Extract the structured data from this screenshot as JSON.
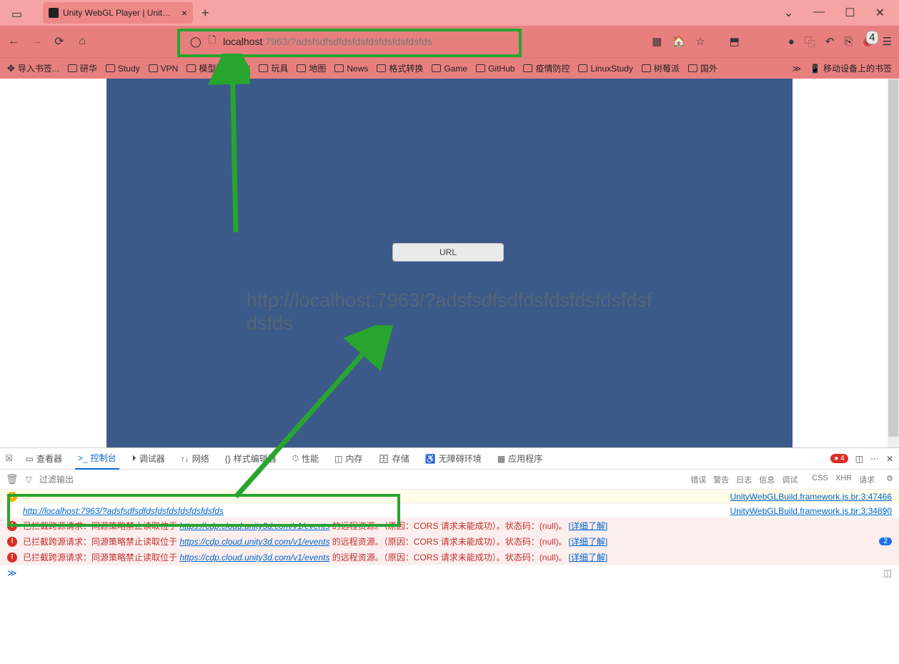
{
  "tab": {
    "title": "Unity WebGL Player | UnityW"
  },
  "url": {
    "host": "localhost",
    "port": ":7963",
    "path": "/?adsfsdfsdfdsfdsfdsfdsfdsfdsfds"
  },
  "bookmarks": {
    "import": "导入书签...",
    "items": [
      "研华",
      "Study",
      "VPN",
      "模型下载网站",
      "玩具",
      "地图",
      "News",
      "格式转换",
      "Game",
      "GitHub",
      "疫情防控",
      "LinuxStudy",
      "树莓派",
      "国外"
    ],
    "mobile": "移动设备上的书签"
  },
  "toolbar_badge": "4",
  "unity": {
    "button": "URL",
    "displayed_url": "http://localhost:7963/?adsfsdfsdfdsfdsfdsfdsfdsfdsfds"
  },
  "devtools": {
    "tabs": [
      "查看器",
      "控制台",
      "调试器",
      "网络",
      "样式编辑器",
      "性能",
      "内存",
      "存储",
      "无障碍环境",
      "应用程序"
    ],
    "active_tab": "控制台",
    "error_count": "4",
    "filter_placeholder": "过滤输出",
    "categories": [
      "错误",
      "警告",
      "日志",
      "信息",
      "调试",
      "CSS",
      "XHR",
      "请求"
    ],
    "rows": [
      {
        "type": "url",
        "text": "http://localhost:7963/?adsfsdfsdfdsfdsfdsfdsfdsfdsfds",
        "src": "UnityWebGLBuild.framework.js.br:3:47466",
        "src_top": "UnityWebGLBuild.framework.js.br:3:34890"
      },
      {
        "type": "err",
        "prefix": "已拦截跨源请求：同源策略禁止读取位于 ",
        "link": "https://cdp.cloud.unity3d.com/v1/events",
        "suffix": " 的远程资源。（原因：CORS 请求未能成功）。状态码：(null)。",
        "learn": "[详细了解]"
      },
      {
        "type": "err",
        "prefix": "已拦截跨源请求：同源策略禁止读取位于 ",
        "link": "https://cdp.cloud.unity3d.com/v1/events",
        "suffix": " 的远程资源。（原因：CORS 请求未能成功）。状态码：(null)。",
        "learn": "[详细了解]",
        "count": "2"
      },
      {
        "type": "err",
        "prefix": "已拦截跨源请求：同源策略禁止读取位于 ",
        "link": "https://cdp.cloud.unity3d.com/v1/events",
        "suffix": " 的远程资源。（原因：CORS 请求未能成功）。状态码：(null)。",
        "learn": "[详细了解]"
      }
    ]
  }
}
